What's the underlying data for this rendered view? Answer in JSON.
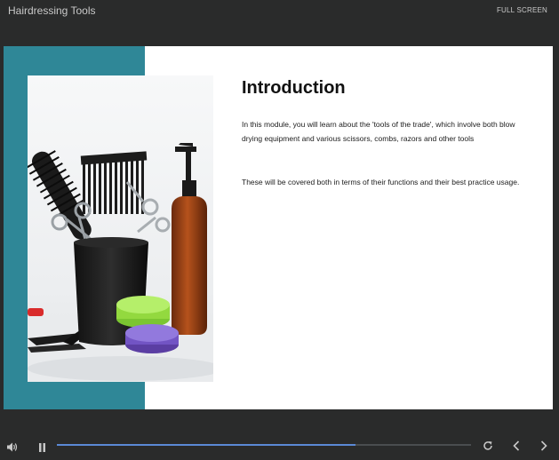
{
  "header": {
    "title": "Hairdressing Tools",
    "fullscreen_label": "FULL SCREEN"
  },
  "slide": {
    "title": "Introduction",
    "paragraphs": [
      "In this module, you will learn about the 'tools of the trade', which involve both blow drying equipment and various scissors, combs, razors and other tools",
      "These will be covered both in terms of their functions and their best practice usage."
    ],
    "image_icon": "hairdressing-tools-photo"
  },
  "controls": {
    "progress": 0.72,
    "icons": [
      "volume-icon",
      "pause-icon",
      "replay-icon",
      "chevron-left-icon",
      "chevron-right-icon"
    ]
  },
  "colors": {
    "background": "#2a2b2b",
    "accent_teal": "#2f8797",
    "progress": "#5b8ad6",
    "text": "#1c1c1c"
  }
}
